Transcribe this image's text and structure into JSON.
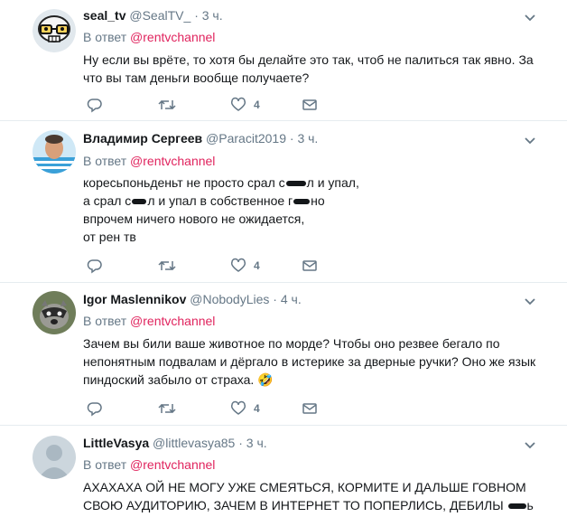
{
  "tweets": [
    {
      "name": "seal_tv",
      "handle": "@SealTV_",
      "dot": "·",
      "time": "3 ч.",
      "reply_prefix": "В ответ",
      "reply_mention": "@rentvchannel",
      "lines": [
        "Ну если вы врёте, то хотя бы делайте это так, чтоб не палиться так явно. За",
        "что вы там деньги вообще получаете?"
      ],
      "likes": "4"
    },
    {
      "name": "Владимир Сергеев",
      "handle": "@Paracit2019",
      "dot": "·",
      "time": "3 ч.",
      "reply_prefix": "В ответ",
      "reply_mention": "@rentvchannel",
      "lines": [
        "коресьпоньденьт не просто срал с",
        "л и упал,",
        "а срал с",
        "л и упал в собственное г",
        "но",
        "впрочем ничего нового не ожидается,",
        "от рен тв"
      ],
      "likes": "4"
    },
    {
      "name": "Igor Maslennikov",
      "handle": "@NobodyLies",
      "dot": "·",
      "time": "4 ч.",
      "reply_prefix": "В ответ",
      "reply_mention": "@rentvchannel",
      "lines": [
        "Зачем вы били ваше животное по морде? Чтобы оно резвее бегало по",
        "непонятным подвалам и дёргало в истерике за дверные ручки? Оно же язык",
        "пиндоский забыло от страха."
      ],
      "emoji": "🤣",
      "likes": "4"
    },
    {
      "name": "LittleVasya",
      "handle": "@littlevasya85",
      "dot": "·",
      "time": "3 ч.",
      "reply_prefix": "В ответ",
      "reply_mention": "@rentvchannel",
      "lines": [
        "АХАХАХА ОЙ НЕ МОГУ УЖЕ СМЕЯТЬСЯ, КОРМИТЕ И ДАЛЬШЕ ГОВНОМ",
        "СВОЮ АУДИТОРИЮ, ЗАЧЕМ В ИНТЕРНЕТ ТО ПОПЕРЛИСЬ, ДЕБИЛЫ",
        "ь"
      ]
    }
  ],
  "colors": {
    "mention": "#e0245e",
    "muted": "#657786",
    "border": "#e6ecf0"
  }
}
